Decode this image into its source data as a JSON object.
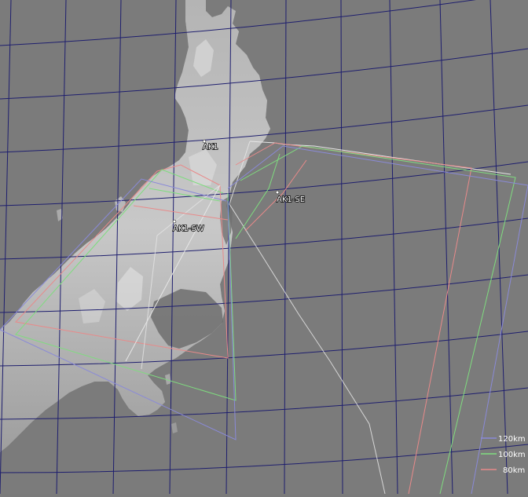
{
  "stations": [
    {
      "id": "ak1",
      "label": "AK1"
    },
    {
      "id": "ak1-se",
      "label": "AK1-SE"
    },
    {
      "id": "ak1-sw",
      "label": "AK1-SW"
    }
  ],
  "legend": [
    {
      "label": "120km",
      "color": "#8a8ad8"
    },
    {
      "label": "100km",
      "color": "#7fdc7f"
    },
    {
      "label": "80km",
      "color": "#e88a8a"
    }
  ],
  "colors": {
    "sea": "#7b7b7b",
    "graticule": "#1e1e6e",
    "land_low": "#a8a8a8",
    "land_high": "#ececec",
    "beam_white": "#e6e6e6"
  }
}
